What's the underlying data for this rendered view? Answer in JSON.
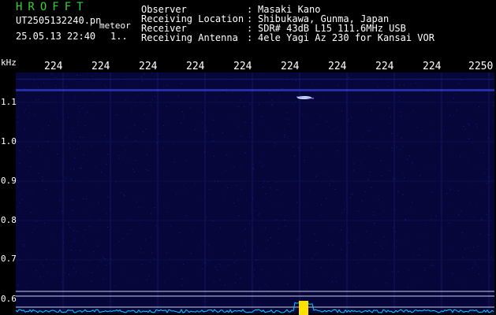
{
  "header": {
    "title": "HROFFT",
    "filename": "UT2505132240.pn",
    "tag": "meteor",
    "datetime": "25.05.13 22:40",
    "count": "1..",
    "fields": [
      {
        "label": "Observer",
        "value": "Masaki Kano"
      },
      {
        "label": "Receiving Location",
        "value": "Shibukawa, Gunma, Japan"
      },
      {
        "label": "Receiver",
        "value": "SDR# 43dB L15 111.6MHz USB"
      },
      {
        "label": "Receiving Antenna",
        "value": "4ele Yagi Az 230 for Kansai VOR"
      }
    ],
    "separator": ":"
  },
  "chart_data": {
    "type": "heatmap",
    "ylabel": "kHz",
    "yticks": [
      "1.1",
      "1.0",
      "0.9",
      "0.8",
      "0.7",
      "0.6"
    ],
    "xticks": [
      "224",
      "224",
      "224",
      "224",
      "224",
      "224",
      "224",
      "224",
      "224",
      "2250"
    ],
    "background_color": "#06063a",
    "signal_color": "#9fa9ff",
    "spectrum_color": "#00d0ff",
    "peak_color": "#ffe000"
  }
}
